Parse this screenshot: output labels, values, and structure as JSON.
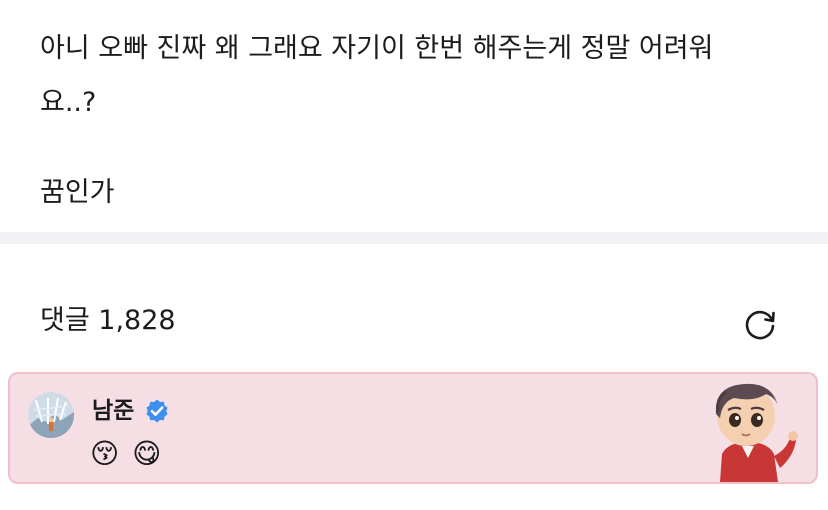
{
  "post": {
    "line1": "아니 오빠 진짜 왜 그래요 자기이 한번 해주는게 정말 어려워",
    "line2": "요..?",
    "line3": "꿈인가"
  },
  "comments": {
    "title": "댓글 1,828",
    "refresh_icon": "refresh-icon"
  },
  "featured_comment": {
    "author": "남준",
    "verified_icon": "verified-badge-icon",
    "emojis": "😚 😋",
    "accent_background": "#f6dfe4",
    "accent_border": "#efc0ca",
    "verified_color": "#3d8ff0"
  }
}
